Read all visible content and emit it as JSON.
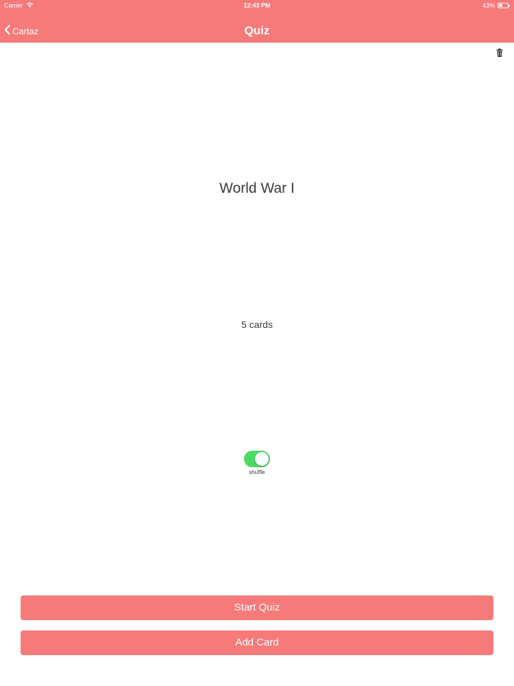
{
  "status_bar": {
    "carrier": "Carrier",
    "time": "12:43 PM",
    "battery": "43%",
    "battery_level": 0.43
  },
  "nav": {
    "back_label": "Cartaz",
    "title": "Quiz"
  },
  "deck": {
    "title": "World War I",
    "card_count": "5 cards"
  },
  "shuffle": {
    "label": "shuffle",
    "on": true
  },
  "actions": {
    "start_quiz": "Start Quiz",
    "add_card": "Add Card"
  },
  "colors": {
    "accent": "#f67a7a",
    "toggle_on": "#4cd964",
    "text": "#3a3a3a"
  },
  "icons": {
    "delete": "trash-icon",
    "back": "chevron-left-icon",
    "wifi": "wifi-icon",
    "battery": "battery-icon"
  }
}
